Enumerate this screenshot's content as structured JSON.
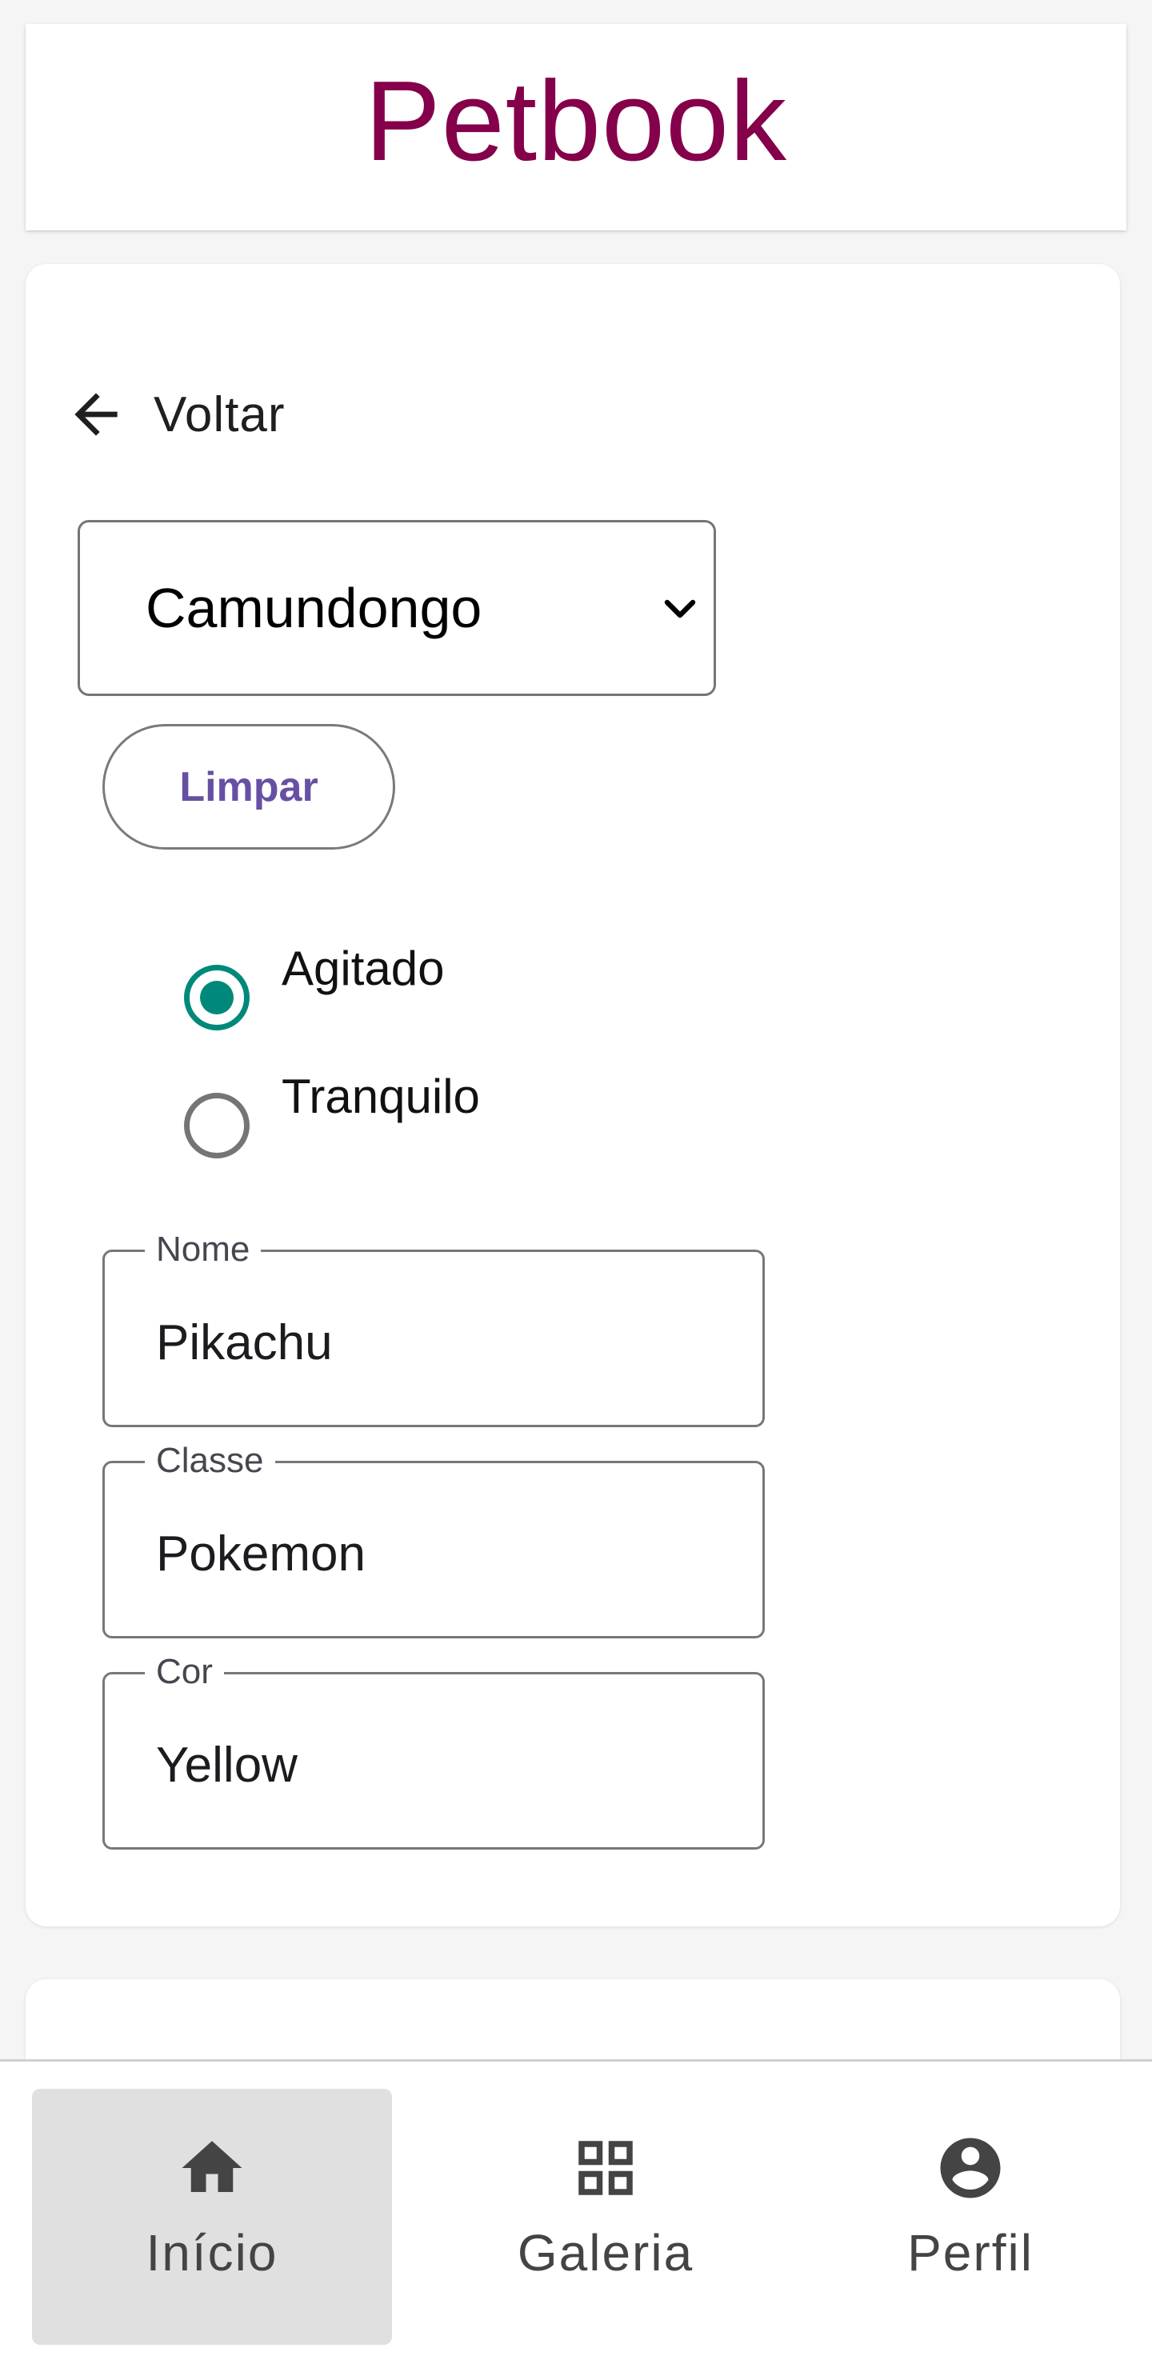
{
  "header": {
    "title": "Petbook"
  },
  "back": {
    "label": "Voltar",
    "icon": "arrow-back-icon"
  },
  "species_select": {
    "value": "Camundongo",
    "icon": "chevron-down-icon"
  },
  "clear_button": {
    "label": "Limpar"
  },
  "temperament": {
    "options": [
      {
        "label": "Agitado",
        "selected": true
      },
      {
        "label": "Tranquilo",
        "selected": false
      }
    ]
  },
  "fields": {
    "nome": {
      "label": "Nome",
      "value": "Pikachu"
    },
    "classe": {
      "label": "Classe",
      "value": "Pokemon"
    },
    "cor": {
      "label": "Cor",
      "value": "Yellow"
    }
  },
  "bottom_nav": {
    "items": [
      {
        "label": "Início",
        "icon": "home-icon",
        "active": true
      },
      {
        "label": "Galeria",
        "icon": "grid-icon",
        "active": false
      },
      {
        "label": "Perfil",
        "icon": "account-circle-icon",
        "active": false
      }
    ]
  },
  "colors": {
    "brand": "#84004b",
    "accent_button_text": "#6750a4",
    "radio_selected": "#00897b",
    "nav_active_bg": "#e0e0e0"
  }
}
